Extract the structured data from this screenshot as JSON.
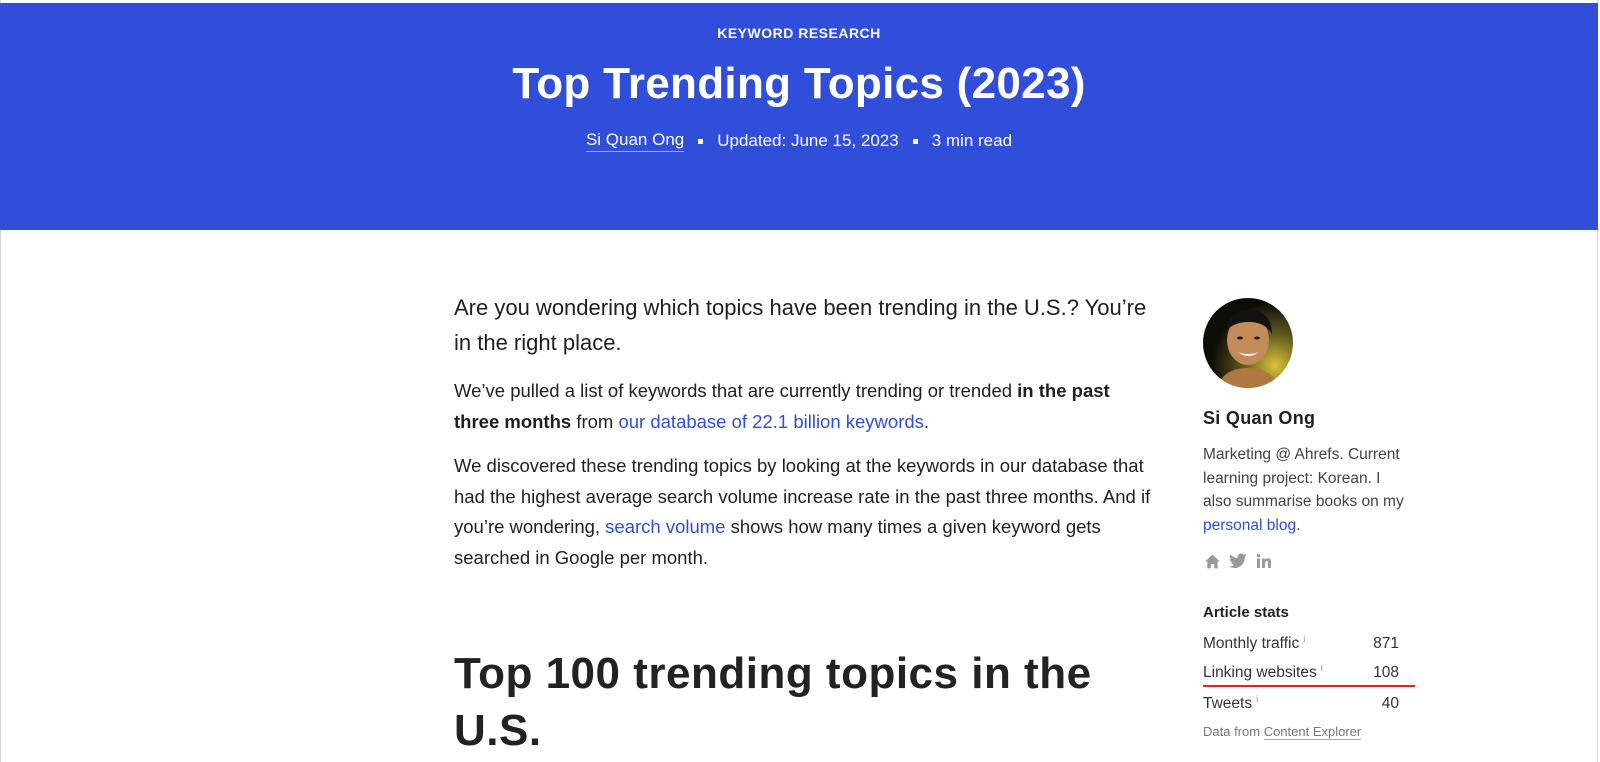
{
  "hero": {
    "category": "KEYWORD RESEARCH",
    "title": "Top Trending Topics (2023)",
    "author": "Si Quan Ong",
    "updated": "Updated: June 15, 2023",
    "read_time": "3 min read"
  },
  "article": {
    "lead": "Are you wondering which topics have been trending in the U.S.? You’re in the right place.",
    "p1": {
      "text_a": "We’ve pulled a list of keywords that are currently trending or trended ",
      "bold": "in the past three months",
      "text_b": " from ",
      "link": "our database of 22.1 billion keywords",
      "text_c": "."
    },
    "p2": {
      "text_a": "We discovered these trending topics by looking at the keywords in our database that had the highest average search volume increase rate in the past three months. And if you’re wondering, ",
      "link": "search volume",
      "text_b": " shows how many times a given keyword gets searched in Google per month."
    },
    "heading": "Top 100 trending topics in the U.S."
  },
  "sidebar": {
    "author_name": "Si Quan Ong",
    "bio_text": "Marketing @ Ahrefs. Current learning project: Korean. I also summarise books on my ",
    "bio_link": "personal blog",
    "bio_end": ".",
    "social_icons": [
      "home-icon",
      "twitter-icon",
      "linkedin-icon"
    ],
    "stats_title": "Article stats",
    "stats": [
      {
        "label": "Monthly traffic",
        "info": "i",
        "value": "871"
      },
      {
        "label": "Linking websites",
        "info": "i",
        "value": "108"
      },
      {
        "label": "Tweets",
        "info": "i",
        "value": "40"
      }
    ],
    "data_from_text": "Data from ",
    "data_from_link": "Content Explorer"
  },
  "colors": {
    "hero_bg": "#314edb",
    "link": "#2f4fd4",
    "highlight_underline": "#e8201f"
  }
}
